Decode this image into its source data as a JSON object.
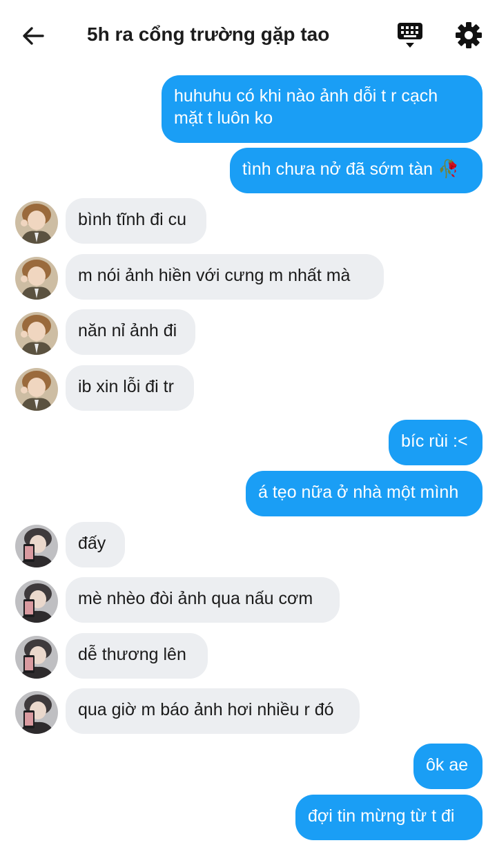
{
  "header": {
    "title": "5h ra cổng trường gặp tao",
    "back_icon": "arrow-left-icon",
    "keyboard_icon": "keyboard-icon",
    "settings_icon": "gear-icon"
  },
  "colors": {
    "outgoing_bubble": "#1a9ef5",
    "incoming_bubble": "#eceef1",
    "outgoing_text": "#ffffff",
    "incoming_text": "#1b1b1b"
  },
  "messages": [
    {
      "from": "me",
      "text": "huhuhu có khi nào ảnh dỗi t r cạch"
    },
    {
      "from": "me",
      "text": "mặt t luôn ko"
    },
    {
      "from": "me",
      "text": "tình chưa nở đã sớm tàn 🥀"
    },
    {
      "from": "a",
      "text": "bình tĩnh đi cu"
    },
    {
      "from": "a",
      "text": "m nói ảnh hiền với cưng m nhất mà"
    },
    {
      "from": "a",
      "text": "năn nỉ ảnh đi"
    },
    {
      "from": "a",
      "text": "ib xin lỗi đi tr"
    },
    {
      "from": "me",
      "text": "bíc rùi :<"
    },
    {
      "from": "me",
      "text": "á tẹo nữa ở nhà một mình"
    },
    {
      "from": "b",
      "text": "đấy"
    },
    {
      "from": "b",
      "text": "mè nhèo đòi ảnh qua nấu cơm"
    },
    {
      "from": "b",
      "text": "dễ thương lên"
    },
    {
      "from": "b",
      "text": "qua giờ m báo ảnh hơi nhiều r đó"
    },
    {
      "from": "me",
      "text": "ôk ae"
    },
    {
      "from": "me",
      "text": "đợi tin mừng từ t đi"
    }
  ]
}
